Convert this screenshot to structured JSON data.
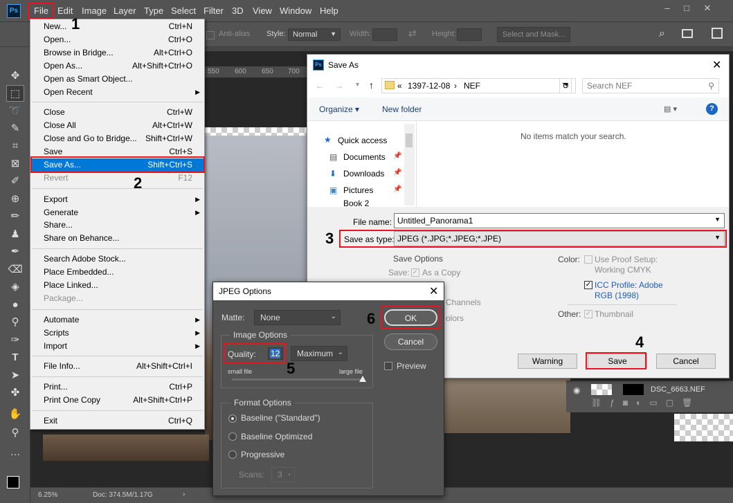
{
  "app": {
    "logo": "Ps"
  },
  "menubar": {
    "items": [
      "File",
      "Edit",
      "Image",
      "Layer",
      "Type",
      "Select",
      "Filter",
      "3D",
      "View",
      "Window",
      "Help"
    ],
    "window_controls": [
      "–",
      "□",
      "✕"
    ]
  },
  "options_bar": {
    "antialias": "Anti-alias",
    "style_label": "Style:",
    "style_value": "Normal",
    "width_label": "Width:",
    "height_label": "Height:",
    "select_mask": "Select and Mask..."
  },
  "rulers": {
    "marks": [
      "550",
      "600",
      "650",
      "700"
    ]
  },
  "status": {
    "zoom": "6.25%",
    "doc": "Doc: 374.5M/1.17G"
  },
  "layers": {
    "layer_name": "DSC_6663.NEF"
  },
  "file_menu": {
    "items": [
      {
        "label": "New...",
        "shortcut": "Ctrl+N"
      },
      {
        "label": "Open...",
        "shortcut": "Ctrl+O"
      },
      {
        "label": "Browse in Bridge...",
        "shortcut": "Alt+Ctrl+O"
      },
      {
        "label": "Open As...",
        "shortcut": "Alt+Shift+Ctrl+O"
      },
      {
        "label": "Open as Smart Object...",
        "shortcut": ""
      },
      {
        "label": "Open Recent",
        "shortcut": ""
      },
      {
        "label": "Close",
        "shortcut": "Ctrl+W"
      },
      {
        "label": "Close All",
        "shortcut": "Alt+Ctrl+W"
      },
      {
        "label": "Close and Go to Bridge...",
        "shortcut": "Shift+Ctrl+W"
      },
      {
        "label": "Save",
        "shortcut": "Ctrl+S"
      },
      {
        "label": "Save As...",
        "shortcut": "Shift+Ctrl+S"
      },
      {
        "label": "Revert",
        "shortcut": "F12"
      },
      {
        "label": "Export",
        "shortcut": ""
      },
      {
        "label": "Generate",
        "shortcut": ""
      },
      {
        "label": "Share...",
        "shortcut": ""
      },
      {
        "label": "Share on Behance...",
        "shortcut": ""
      },
      {
        "label": "Search Adobe Stock...",
        "shortcut": ""
      },
      {
        "label": "Place Embedded...",
        "shortcut": ""
      },
      {
        "label": "Place Linked...",
        "shortcut": ""
      },
      {
        "label": "Package...",
        "shortcut": ""
      },
      {
        "label": "Automate",
        "shortcut": ""
      },
      {
        "label": "Scripts",
        "shortcut": ""
      },
      {
        "label": "Import",
        "shortcut": ""
      },
      {
        "label": "File Info...",
        "shortcut": "Alt+Shift+Ctrl+I"
      },
      {
        "label": "Print...",
        "shortcut": "Ctrl+P"
      },
      {
        "label": "Print One Copy",
        "shortcut": "Alt+Shift+Ctrl+P"
      },
      {
        "label": "Exit",
        "shortcut": "Ctrl+Q"
      }
    ]
  },
  "steps": [
    "1",
    "2",
    "3",
    "4",
    "5",
    "6"
  ],
  "save_as": {
    "title": "Save As",
    "path": [
      "«",
      "1397-12-08",
      "›",
      "NEF"
    ],
    "search_placeholder": "Search NEF",
    "organize": "Organize ▾",
    "new_folder": "New folder",
    "empty_msg": "No items match your search.",
    "nav": [
      "Quick access",
      "Documents",
      "Downloads",
      "Pictures",
      "Book 2"
    ],
    "file_name_label": "File name:",
    "file_name": "Untitled_Panorama1",
    "type_label": "Save as type:",
    "type_value": "JPEG (*.JPG;*.JPEG;*.JPE)",
    "save_options": "Save Options",
    "save_label": "Save:",
    "as_copy": "As a Copy",
    "channels": "Channels",
    "colors": "olors",
    "color_label": "Color:",
    "proof_setup": "Use Proof Setup:",
    "working_cmyk": "Working CMYK",
    "icc_line1": "ICC Profile:  Adobe",
    "icc_line2": "RGB (1998)",
    "other_label": "Other:",
    "thumbnail": "Thumbnail",
    "warning": "Warning",
    "save": "Save",
    "cancel": "Cancel"
  },
  "jpeg_options": {
    "title": "JPEG Options",
    "matte_label": "Matte:",
    "matte_value": "None",
    "image_options": "Image Options",
    "quality_label": "Quality:",
    "quality_value": "12",
    "quality_preset": "Maximum",
    "quality_fraction": 1.0,
    "small_file": "small file",
    "large_file": "large file",
    "format_options": "Format Options",
    "baseline_standard": "Baseline (\"Standard\")",
    "baseline_optimized": "Baseline Optimized",
    "progressive": "Progressive",
    "scans_label": "Scans:",
    "scans_value": "3",
    "ok": "OK",
    "cancel": "Cancel",
    "preview": "Preview"
  }
}
